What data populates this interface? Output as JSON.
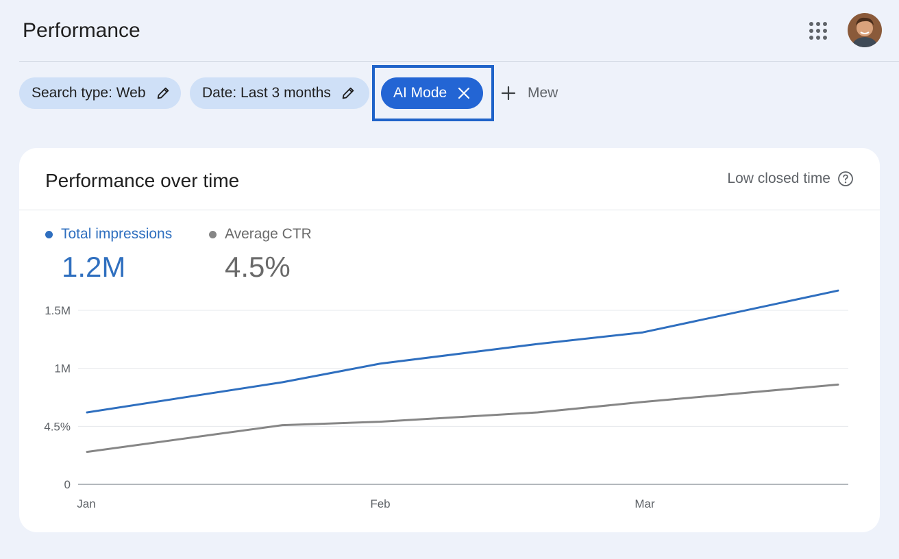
{
  "header": {
    "title": "Performance"
  },
  "filters": {
    "search_type": "Search type: Web",
    "date": "Date: Last 3 months",
    "ai_mode": "AI Mode",
    "add_label": "Mew"
  },
  "card": {
    "title": "Performance over time",
    "help_label": "Low closed time"
  },
  "metrics": [
    {
      "label": "Total impressions",
      "value": "1.2M",
      "color": "#2f6fbf"
    },
    {
      "label": "Average CTR",
      "value": "4.5%",
      "color": "#7a7a7a"
    }
  ],
  "chart_data": {
    "type": "line",
    "x_labels": [
      "Jan",
      "Feb",
      "Mar"
    ],
    "y_tick_labels": [
      "0",
      "4.5%",
      "1M",
      "1.5M"
    ],
    "series": [
      {
        "name": "Total impressions",
        "color": "#2f6fbf",
        "points": [
          {
            "x": 0.0,
            "y": 0.62
          },
          {
            "x": 0.26,
            "y": 0.88
          },
          {
            "x": 0.39,
            "y": 1.04
          },
          {
            "x": 0.6,
            "y": 1.21
          },
          {
            "x": 0.74,
            "y": 1.31
          },
          {
            "x": 1.0,
            "y": 1.67
          }
        ]
      },
      {
        "name": "Average CTR",
        "color": "#868686",
        "points": [
          {
            "x": 0.0,
            "y": 0.28
          },
          {
            "x": 0.26,
            "y": 0.51
          },
          {
            "x": 0.39,
            "y": 0.54
          },
          {
            "x": 0.6,
            "y": 0.62
          },
          {
            "x": 0.74,
            "y": 0.71
          },
          {
            "x": 1.0,
            "y": 0.86
          }
        ]
      }
    ],
    "ylim": [
      0,
      1.5
    ],
    "grid": true
  }
}
